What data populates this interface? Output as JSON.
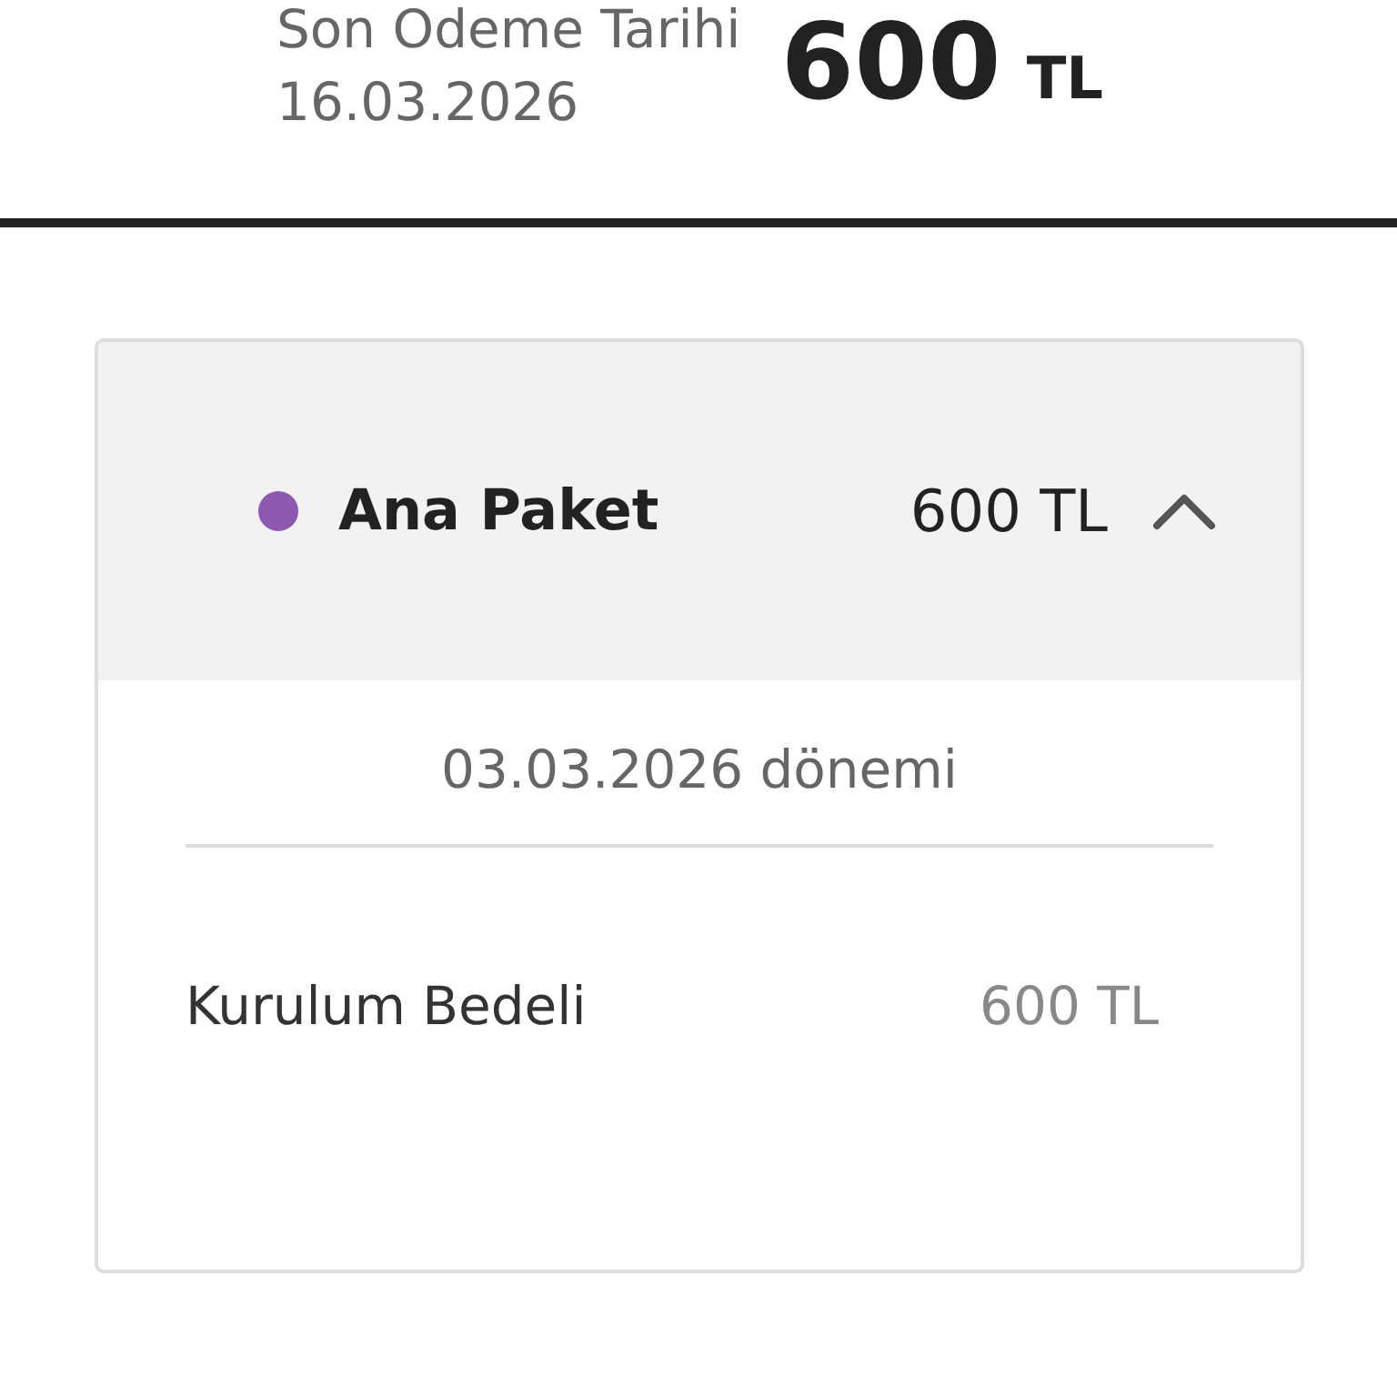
{
  "due": {
    "label": "Son Odeme Tarihi",
    "date": "16.03.2026",
    "amount": "600",
    "currency": "TL"
  },
  "package": {
    "name": "Ana Paket",
    "color": "#8e57b0",
    "total": "600 TL",
    "expanded": true,
    "period": "03.03.2026 dönemi",
    "items": [
      {
        "name": "Kurulum Bedeli",
        "amount": "600 TL"
      }
    ]
  }
}
